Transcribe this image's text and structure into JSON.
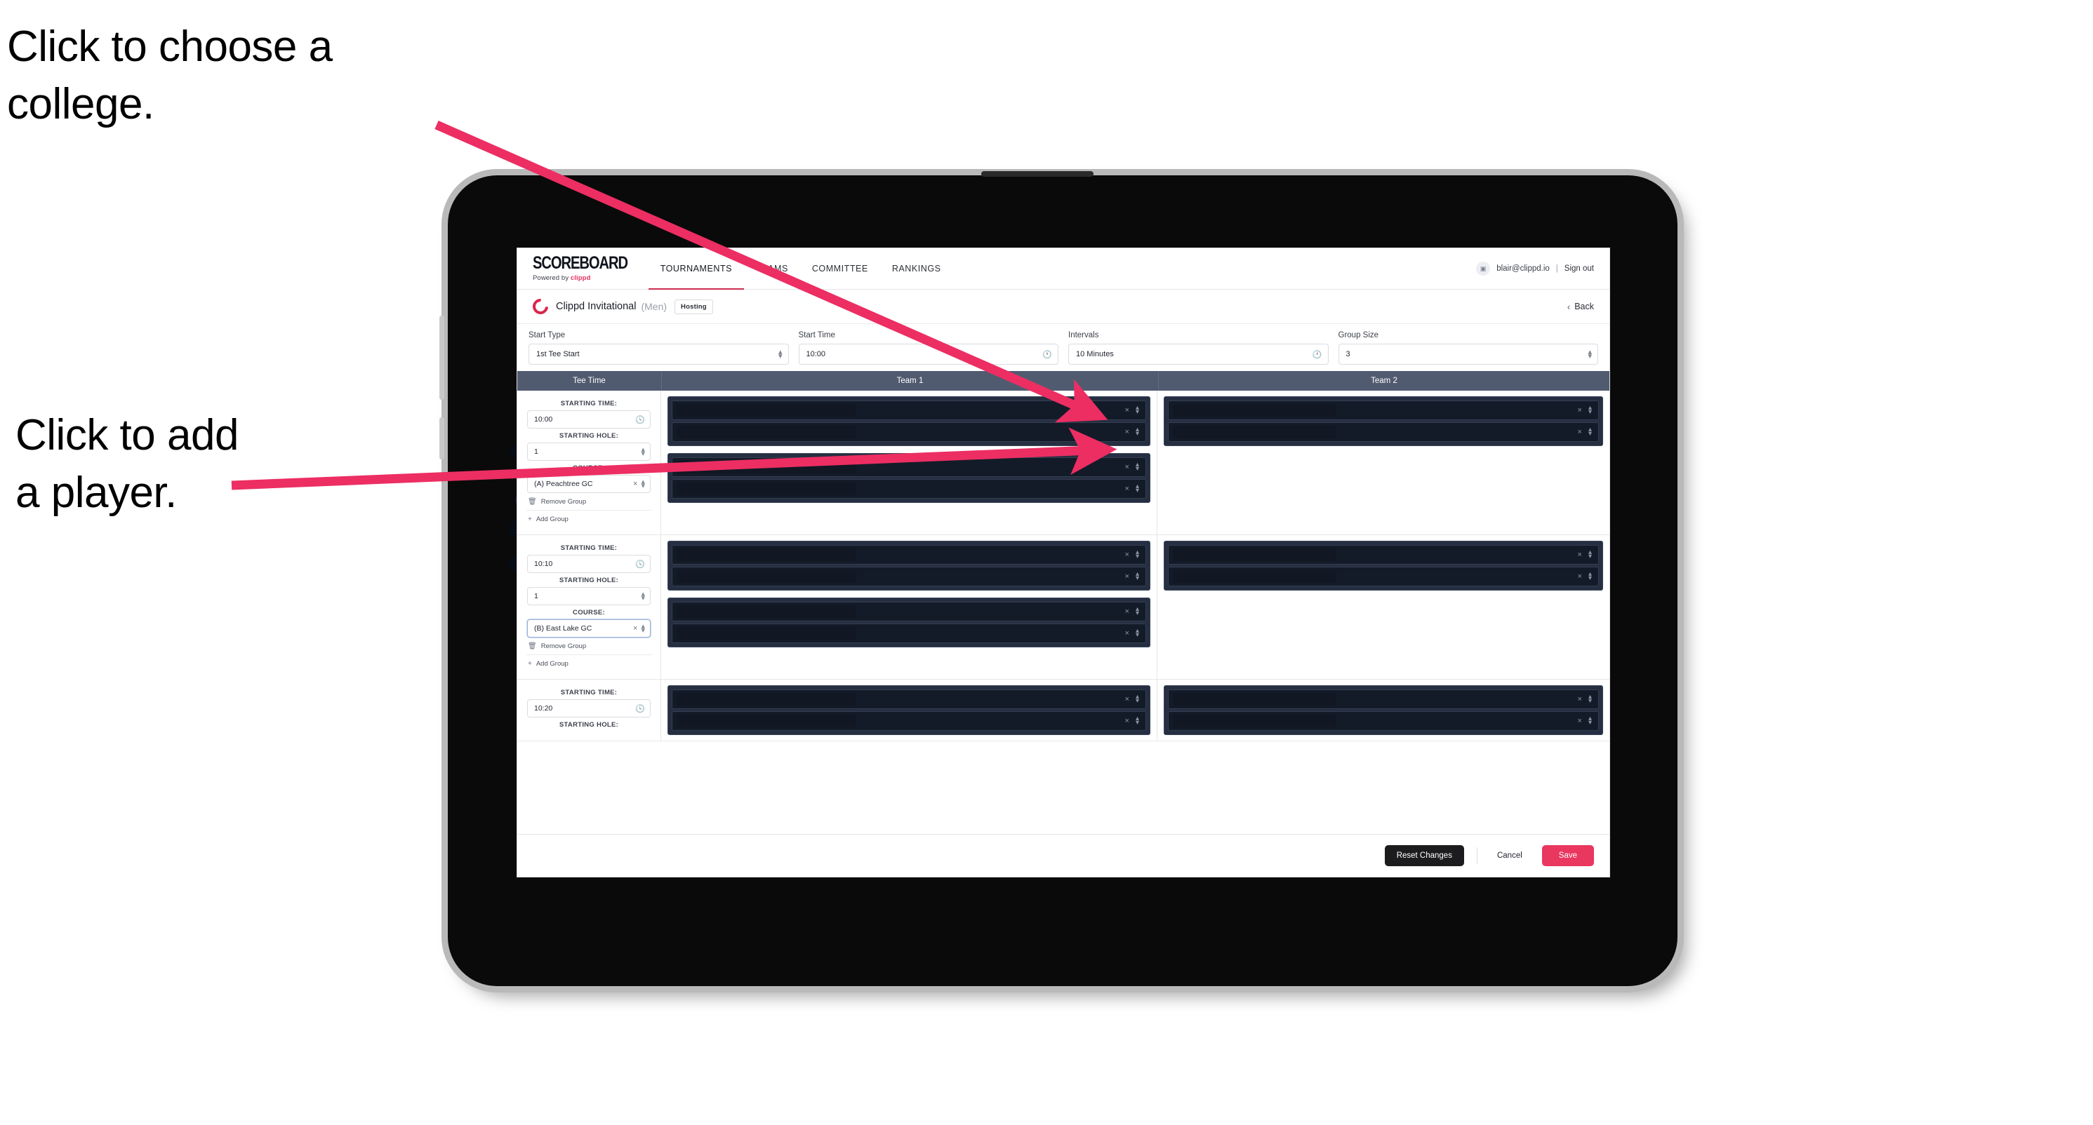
{
  "annotations": [
    {
      "id": "college",
      "text": "Click to choose a\ncollege."
    },
    {
      "id": "player",
      "text": "Click to add\na player."
    }
  ],
  "colors": {
    "accent_pink": "#e9375f",
    "arrow_pink": "#ec2e63",
    "nav_underline": "#cf2d4f",
    "table_header": "#515b70",
    "player_field": "#141b28",
    "player_group": "#262f41"
  },
  "nav": {
    "brand_word": "SCOREBOARD",
    "brand_sub_prefix": "Powered by",
    "brand_sub_name": "clippd",
    "tabs": [
      {
        "label": "TOURNAMENTS",
        "active": true
      },
      {
        "label": "TEAMS",
        "active": false
      },
      {
        "label": "COMMITTEE",
        "active": false
      },
      {
        "label": "RANKINGS",
        "active": false
      }
    ],
    "avatar_icon": "user-avatar-icon",
    "email": "blair@clippd.io",
    "divider": "|",
    "sign_out": "Sign out"
  },
  "tournament_bar": {
    "logo_icon": "clippd-c-logo-icon",
    "name": "Clippd Invitational",
    "gender": "(Men)",
    "badge": "Hosting",
    "back_chevron": "‹",
    "back_label": "Back"
  },
  "filters": [
    {
      "label": "Start Type",
      "value": "1st Tee Start",
      "icon": "stepper-icon"
    },
    {
      "label": "Start Time",
      "value": "10:00",
      "icon": "clock-icon"
    },
    {
      "label": "Intervals",
      "value": "10 Minutes",
      "icon": "clock-icon"
    },
    {
      "label": "Group Size",
      "value": "3",
      "icon": "stepper-icon"
    }
  ],
  "table": {
    "headers": [
      "Tee Time",
      "Team 1",
      "Team 2"
    ],
    "field_labels": {
      "time": "STARTING TIME:",
      "hole": "STARTING HOLE:",
      "course": "COURSE:"
    },
    "actions": {
      "remove": "Remove Group",
      "remove_icon": "trash-icon",
      "add": "Add Group",
      "add_icon": "plus-icon"
    },
    "rows": [
      {
        "time": "10:00",
        "hole": "1",
        "course": "(A) Peachtree GC",
        "course_focused": false,
        "team1_groups": [
          2,
          2
        ],
        "team2_groups": [
          2
        ]
      },
      {
        "time": "10:10",
        "hole": "1",
        "course": "(B) East Lake GC",
        "course_focused": true,
        "team1_groups": [
          2,
          2
        ],
        "team2_groups": [
          2
        ]
      },
      {
        "time": "10:20",
        "hole": "",
        "course": "",
        "course_focused": false,
        "team1_groups": [
          2
        ],
        "team2_groups": [
          2
        ]
      }
    ],
    "clear_icon": "close-x-icon",
    "spinner_icon": "stepper-icon"
  },
  "footer": {
    "reset": "Reset Changes",
    "cancel": "Cancel",
    "save": "Save"
  }
}
